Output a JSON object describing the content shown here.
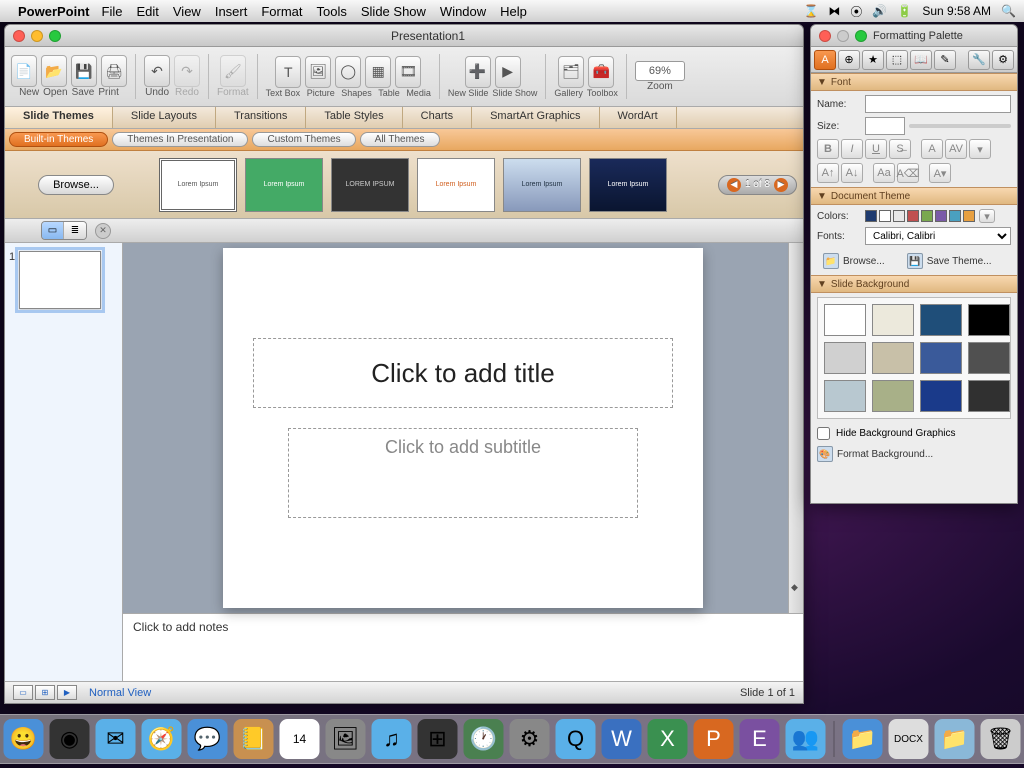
{
  "menubar": {
    "app": "PowerPoint",
    "items": [
      "File",
      "Edit",
      "View",
      "Insert",
      "Format",
      "Tools",
      "Slide Show",
      "Window",
      "Help"
    ],
    "clock": "Sun 9:58 AM"
  },
  "window": {
    "title": "Presentation1",
    "toolbar": {
      "groups": [
        {
          "icons": [
            "📄",
            "📂",
            "💾",
            "🖨"
          ],
          "labels": [
            "New",
            "Open",
            "Save",
            "Print"
          ]
        },
        {
          "icons": [
            "↶",
            "↷"
          ],
          "labels": [
            "Undo",
            "Redo"
          ]
        },
        {
          "icons": [
            "🖌"
          ],
          "labels": [
            "Format"
          ]
        },
        {
          "icons": [
            "T",
            "🖼",
            "◯",
            "▦",
            "🎞"
          ],
          "labels": [
            "Text Box",
            "Picture",
            "Shapes",
            "Table",
            "Media"
          ]
        },
        {
          "icons": [
            "➕",
            "▶"
          ],
          "labels": [
            "New Slide",
            "Slide Show"
          ]
        },
        {
          "icons": [
            "🗂",
            "🧰"
          ],
          "labels": [
            "Gallery",
            "Toolbox"
          ]
        }
      ],
      "zoom_value": "69%",
      "zoom_label": "Zoom"
    },
    "ribbon_tabs": [
      "Slide Themes",
      "Slide Layouts",
      "Transitions",
      "Table Styles",
      "Charts",
      "SmartArt Graphics",
      "WordArt"
    ],
    "theme_subtabs": [
      "Built-in Themes",
      "Themes In Presentation",
      "Custom Themes",
      "All Themes"
    ],
    "browse": "Browse...",
    "theme_thumbs": [
      "Lorem Ipsum",
      "Lorem Ipsum",
      "LOREM IPSUM",
      "Lorem Ipsum",
      "Lorem Ipsum",
      "Lorem Ipsum"
    ],
    "pager": "1 of 8",
    "slide_num": "1",
    "title_ph": "Click to add title",
    "subtitle_ph": "Click to add subtitle",
    "notes_ph": "Click to add notes",
    "status_view": "Normal View",
    "status_slide": "Slide 1 of 1"
  },
  "palette": {
    "title": "Formatting Palette",
    "sections": {
      "font": "Font",
      "doc_theme": "Document Theme",
      "slide_bg": "Slide Background"
    },
    "font_name_label": "Name:",
    "font_size_label": "Size:",
    "colors_label": "Colors:",
    "fonts_label": "Fonts:",
    "fonts_value": "Calibri, Calibri",
    "browse": "Browse...",
    "save_theme": "Save Theme...",
    "hide_bg": "Hide Background Graphics",
    "format_bg": "Format Background...",
    "theme_colors": [
      "#1f3b6f",
      "#ffffff",
      "#e8e8e8",
      "#c05050",
      "#7aa84f",
      "#7a5aa8",
      "#4aa0c0",
      "#e8a040"
    ],
    "bg_colors": [
      "#ffffff",
      "#ece9dc",
      "#1f4e79",
      "#000000",
      "#d0d0d0",
      "#c8c0a8",
      "#3a5a9a",
      "#505050",
      "#b8c8d0",
      "#a8b088",
      "#1a3a8a",
      "#303030"
    ]
  }
}
